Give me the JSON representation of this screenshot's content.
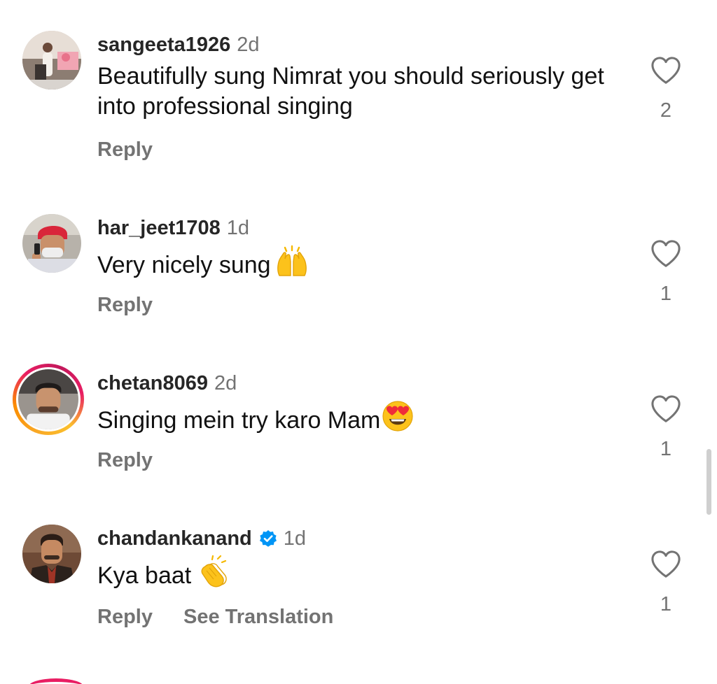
{
  "comments": [
    {
      "username": "sangeeta1926",
      "time": "2d",
      "text": "Beautifully sung Nimrat you should seriously get into professional singing",
      "reply_label": "Reply",
      "likes": "2",
      "avatar": "user-photo",
      "verified": false,
      "story_ring": false
    },
    {
      "username": "har_jeet1708",
      "time": "1d",
      "text": "Very nicely sung",
      "emoji": "raising-hands-emoji",
      "reply_label": "Reply",
      "likes": "1",
      "avatar": "user-photo",
      "verified": false,
      "story_ring": false
    },
    {
      "username": "chetan8069",
      "time": "2d",
      "text": "Singing mein try karo Mam",
      "emoji": "heart-eyes-emoji",
      "reply_label": "Reply",
      "likes": "1",
      "avatar": "user-photo",
      "verified": false,
      "story_ring": true
    },
    {
      "username": "chandankanand",
      "time": "1d",
      "text": "Kya baat",
      "emoji": "clapping-hands-emoji",
      "reply_label": "Reply",
      "see_translation_label": "See Translation",
      "likes": "1",
      "avatar": "user-photo",
      "verified": true,
      "story_ring": false
    }
  ],
  "icons": {
    "like": "heart-outline-icon",
    "verified": "verified-badge-icon"
  },
  "colors": {
    "text": "#111111",
    "username": "#262626",
    "secondary": "#737373",
    "verified_blue": "#0095f6",
    "story_ring_pink": "#e91e63",
    "story_ring_orange": "#fb8c00"
  }
}
